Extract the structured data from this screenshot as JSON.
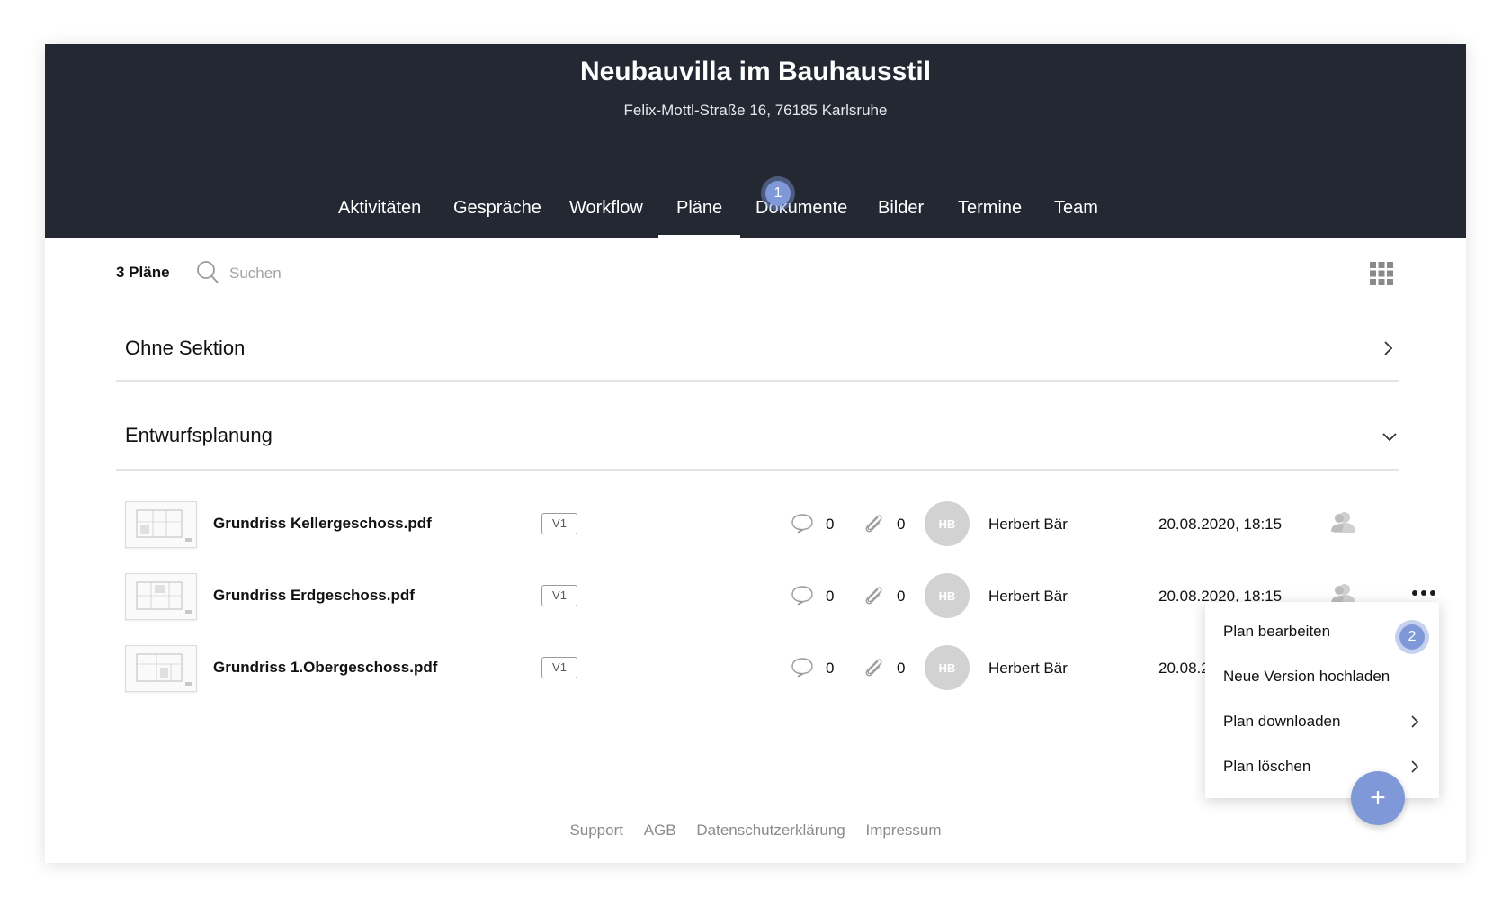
{
  "project": {
    "title": "Neubauvilla im Bauhausstil",
    "address": "Felix-Mottl-Straße 16, 76185 Karlsruhe"
  },
  "tabs": [
    {
      "label": "Aktivitäten"
    },
    {
      "label": "Gespräche"
    },
    {
      "label": "Workflow"
    },
    {
      "label": "Pläne",
      "active": true
    },
    {
      "label": "Dokumente"
    },
    {
      "label": "Bilder"
    },
    {
      "label": "Termine"
    },
    {
      "label": "Team"
    }
  ],
  "step_badges": [
    "1",
    "2"
  ],
  "toolbar": {
    "count_label": "3 Pläne",
    "search_placeholder": "Suchen",
    "view_icon": "grid-icon"
  },
  "sections": [
    {
      "title": "Ohne Sektion",
      "state": "collapsed"
    },
    {
      "title": "Entwurfsplanung",
      "state": "expanded"
    }
  ],
  "plans": [
    {
      "name": "Grundriss Kellergeschoss.pdf",
      "version": "V1",
      "comments": "0",
      "attachments": "0",
      "user_initials": "HB",
      "user_name": "Herbert Bär",
      "date": "20.08.2020, 18:15"
    },
    {
      "name": "Grundriss Erdgeschoss.pdf",
      "version": "V1",
      "comments": "0",
      "attachments": "0",
      "user_initials": "HB",
      "user_name": "Herbert Bär",
      "date": "20.08.2020, 18:15"
    },
    {
      "name": "Grundriss 1.Obergeschoss.pdf",
      "version": "V1",
      "comments": "0",
      "attachments": "0",
      "user_initials": "HB",
      "user_name": "Herbert Bär",
      "date": "20.08.20"
    }
  ],
  "context_menu": {
    "items": [
      {
        "label": "Plan bearbeiten"
      },
      {
        "label": "Neue Version hochladen"
      },
      {
        "label": "Plan downloaden",
        "has_submenu": true
      },
      {
        "label": "Plan löschen",
        "has_submenu": true
      }
    ]
  },
  "footer": {
    "links": [
      "Support",
      "AGB",
      "Datenschutzerklärung",
      "Impressum"
    ]
  },
  "fab": {
    "label": "+"
  },
  "colors": {
    "header_bg": "#232833",
    "accent": "#7f99d8",
    "divider": "#e4e4e4",
    "avatar_bg": "#d2d2d2"
  }
}
